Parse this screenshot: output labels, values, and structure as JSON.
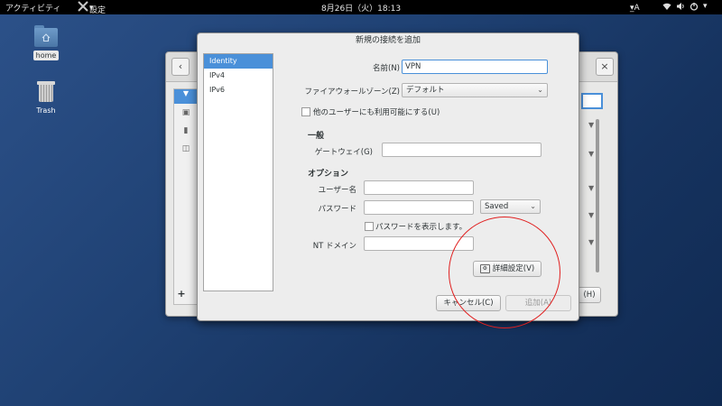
{
  "topbar": {
    "activities": "アクティビティ",
    "app_menu": "設定",
    "clock": "8月26日（火）18:13",
    "input_method": "_A"
  },
  "desktop": {
    "home_label": "home",
    "trash_label": "Trash"
  },
  "bg_window": {
    "partial_button": "(H)"
  },
  "dialog": {
    "title": "新規の接続を追加",
    "sidebar": [
      "Identity",
      "IPv4",
      "IPv6"
    ],
    "name_label": "名前(N)",
    "name_value": "VPN",
    "firewall_label": "ファイアウォールゾーン(Z)",
    "firewall_value": "デフォルト",
    "all_users_label": "他のユーザーにも利用可能にする(U)",
    "general_section": "一般",
    "gateway_label": "ゲートウェイ(G)",
    "gateway_value": "",
    "options_section": "オプション",
    "username_label": "ユーザー名",
    "username_value": "",
    "password_label": "パスワード",
    "password_value": "",
    "password_mode": "Saved",
    "show_password_label": "パスワードを表示します。",
    "nt_domain_label": "NT ドメイン",
    "nt_domain_value": "",
    "advanced_button": "詳細設定(V)",
    "cancel_button": "キャンセル(C)",
    "add_button": "追加(A)"
  },
  "colors": {
    "selection": "#4a90d9",
    "annotation_circle": "#e02020",
    "desktop": "#1f4173"
  }
}
